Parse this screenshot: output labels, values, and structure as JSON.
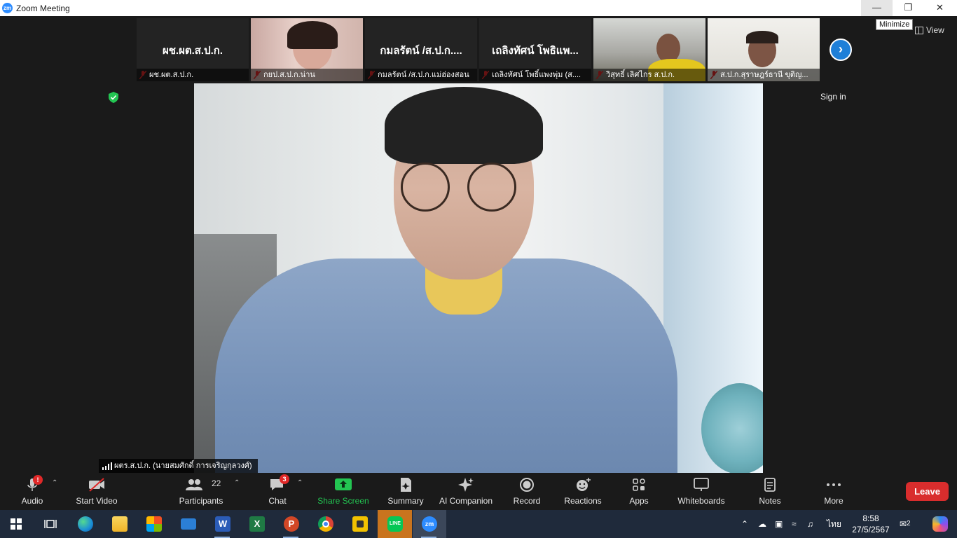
{
  "window": {
    "title": "Zoom Meeting",
    "logo_text": "zm",
    "minimize_tooltip": "Minimize",
    "view_label": "View",
    "sign_in_label": "Sign in"
  },
  "thumbnails": [
    {
      "display_name": "ผช.ผต.ส.ป.ก.",
      "caption": "ผช.ผต.ส.ป.ก.",
      "video": false
    },
    {
      "display_name": "",
      "caption": "กยป.ส.ป.ก.น่าน",
      "video": true
    },
    {
      "display_name": "กมลรัตน์ /ส.ป.ก....",
      "caption": "กมลรัตน์ /ส.ป.ก.แม่ฮ่องสอน",
      "video": false
    },
    {
      "display_name": "เถลิงทัศน์ โพธิแพ...",
      "caption": "เถลิงทัศน์ โพธิ์แพงพุ่ม (ส....",
      "video": false
    },
    {
      "display_name": "",
      "caption": "วิสุทธิ์ เลิศไกร ส.ป.ก.",
      "video": true
    },
    {
      "display_name": "",
      "caption": "ส.ป.ก.สุราษฎร์ธานี ขุติญ...",
      "video": true
    }
  ],
  "active_speaker": {
    "name": "ผตร.ส.ป.ก. (นายสมศักดิ์ การเจริญกุลวงศ์)"
  },
  "toolbar": {
    "audio": {
      "label": "Audio",
      "badge": "!"
    },
    "video": {
      "label": "Start Video"
    },
    "participants": {
      "label": "Participants",
      "count": "22"
    },
    "chat": {
      "label": "Chat",
      "badge": "3"
    },
    "share": {
      "label": "Share Screen"
    },
    "summary": {
      "label": "Summary"
    },
    "ai": {
      "label": "AI Companion"
    },
    "record": {
      "label": "Record"
    },
    "reactions": {
      "label": "Reactions"
    },
    "apps": {
      "label": "Apps"
    },
    "whiteboards": {
      "label": "Whiteboards"
    },
    "notes": {
      "label": "Notes"
    },
    "more": {
      "label": "More"
    },
    "leave": {
      "label": "Leave"
    }
  },
  "taskbar": {
    "apps": [
      "start-icon",
      "task-view-icon",
      "edge-icon",
      "file-explorer-icon",
      "store-icon",
      "mail-icon",
      "word-icon",
      "excel-icon",
      "powerpoint-icon",
      "chrome-icon",
      "sticky-app-icon",
      "line-icon",
      "zoom-icon"
    ],
    "language": "ไทย",
    "time": "8:58",
    "date": "27/5/2567",
    "notification_count": "2"
  },
  "colors": {
    "accent_blue": "#2d8cff",
    "share_green": "#23c552",
    "leave_red": "#d92d2d",
    "badge_red": "#e02828"
  }
}
